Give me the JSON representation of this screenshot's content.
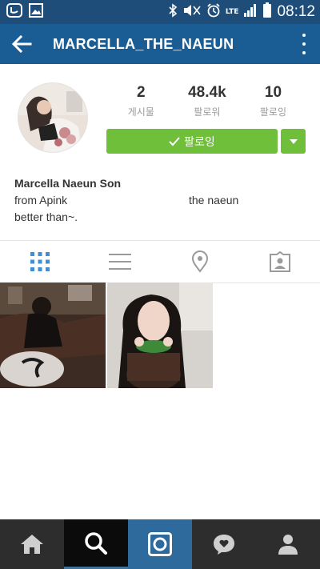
{
  "status_bar": {
    "time": "08:12",
    "network_type": "LTE",
    "icons": [
      "facebook-messenger-icon",
      "gallery-icon",
      "bluetooth-icon",
      "mute-icon",
      "alarm-icon",
      "lte-icon",
      "signal-icon",
      "battery-icon"
    ]
  },
  "app_bar": {
    "title": "MARCELLA_THE_NAEUN",
    "back_icon": "back-arrow-icon",
    "more_icon": "more-vert-icon"
  },
  "profile": {
    "stats": [
      {
        "value": "2",
        "label": "게시물"
      },
      {
        "value": "48.4k",
        "label": "팔로워"
      },
      {
        "value": "10",
        "label": "팔로잉"
      }
    ],
    "follow_button_label": "팔로잉",
    "name": "Marcella  Naeun Son",
    "bio_lines": [
      {
        "left": "from Apink",
        "right": "the naeun"
      },
      {
        "left": "better than~.",
        "right": ""
      }
    ]
  },
  "tabs": [
    {
      "name": "grid-view",
      "icon": "grid-icon",
      "active": true
    },
    {
      "name": "list-view",
      "icon": "list-icon",
      "active": false
    },
    {
      "name": "places",
      "icon": "location-pin-icon",
      "active": false
    },
    {
      "name": "tagged",
      "icon": "tagged-person-icon",
      "active": false
    }
  ],
  "bottom_nav": [
    {
      "name": "home",
      "icon": "home-icon"
    },
    {
      "name": "search",
      "icon": "search-icon",
      "active": true
    },
    {
      "name": "camera",
      "icon": "camera-icon"
    },
    {
      "name": "activity",
      "icon": "heart-bubble-icon"
    },
    {
      "name": "profile",
      "icon": "person-icon"
    }
  ],
  "colors": {
    "status_bar": "#1e4d7a",
    "app_bar": "#1a5d95",
    "follow_green": "#6fbf3a",
    "active_tab": "#3f8fd2",
    "bottom_nav": "#2d2d2d"
  }
}
